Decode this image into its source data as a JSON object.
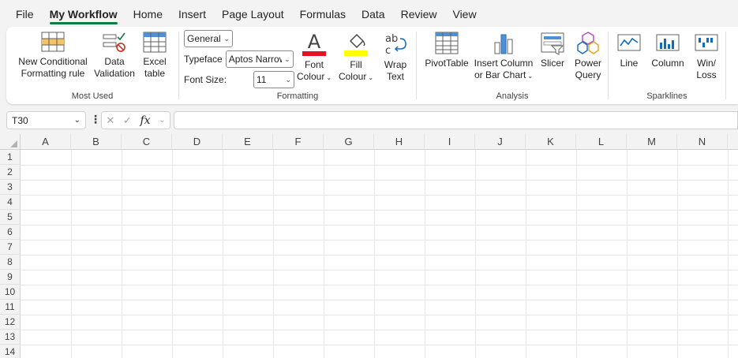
{
  "tabs": [
    "File",
    "My Workflow",
    "Home",
    "Insert",
    "Page Layout",
    "Formulas",
    "Data",
    "Review",
    "View"
  ],
  "active_tab": "My Workflow",
  "ribbon": {
    "most_used": {
      "label": "Most Used",
      "cond_fmt": [
        "New Conditional",
        "Formatting rule"
      ],
      "data_validation": [
        "Data",
        "Validation"
      ],
      "excel_table": [
        "Excel",
        "table"
      ]
    },
    "formatting": {
      "label": "Formatting",
      "number_format": "General",
      "typeface_label": "Typeface",
      "typeface_value": "Aptos Narrow",
      "font_size_label": "Font Size:",
      "font_size_value": "11",
      "font_colour": [
        "Font",
        "Colour"
      ],
      "fill_colour": [
        "Fill",
        "Colour"
      ],
      "wrap_text": [
        "Wrap",
        "Text"
      ],
      "font_colour_hex": "#e81123",
      "fill_colour_hex": "#ffff00"
    },
    "analysis": {
      "label": "Analysis",
      "pivot": "PivotTable",
      "insert_column": [
        "Insert Column",
        "or Bar Chart"
      ],
      "slicer": "Slicer",
      "power_query": [
        "Power",
        "Query"
      ]
    },
    "sparklines": {
      "label": "Sparklines",
      "line": "Line",
      "column": "Column",
      "winloss": [
        "Win/",
        "Loss"
      ]
    }
  },
  "formula_bar": {
    "name_box": "T30",
    "fx": "fx",
    "value": ""
  },
  "columns": [
    "A",
    "B",
    "C",
    "D",
    "E",
    "F",
    "G",
    "H",
    "I",
    "J",
    "K",
    "L",
    "M",
    "N"
  ],
  "rows": [
    "1",
    "2",
    "3",
    "4",
    "5",
    "6",
    "7",
    "8",
    "9",
    "10",
    "11",
    "12",
    "13",
    "14"
  ],
  "accent": "#107c41"
}
